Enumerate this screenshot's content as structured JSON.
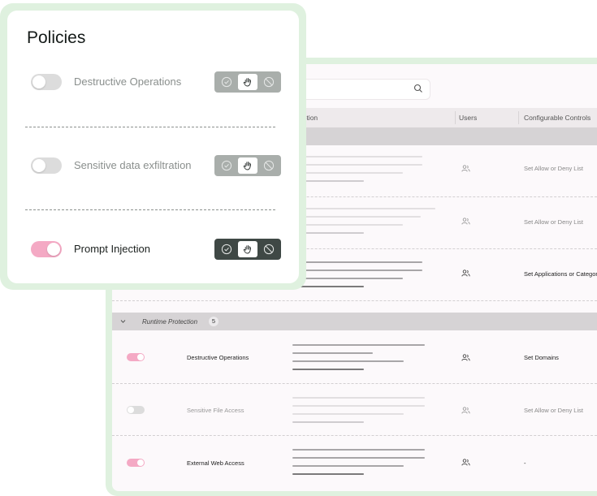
{
  "policies_card": {
    "title": "Policies",
    "items": [
      {
        "label": "Destructive Operations",
        "enabled": false,
        "selected_action": "hand"
      },
      {
        "label": "Sensitive data exfiltration",
        "enabled": false,
        "selected_action": "hand"
      },
      {
        "label": "Prompt Injection",
        "enabled": true,
        "selected_action": "hand"
      }
    ],
    "actions": [
      "check-icon",
      "hand-icon",
      "block-icon"
    ]
  },
  "table": {
    "columns": {
      "description": "ription",
      "users": "Users",
      "controls": "Configurable Controls"
    },
    "rows_top": [
      {
        "control": "Set Allow or Deny List",
        "muted": true
      },
      {
        "control": "Set Allow or Deny List",
        "muted": true
      },
      {
        "control": "Set Applications or Categor",
        "muted": false
      }
    ],
    "group": {
      "label": "Runtime Protection",
      "count": "5"
    },
    "rows_group": [
      {
        "name": "Destructive Operations",
        "control": "Set Domains",
        "enabled": true,
        "muted": false
      },
      {
        "name": "Sensitive File Access",
        "control": "Set Allow or Deny List",
        "enabled": false,
        "muted": true
      },
      {
        "name": "External Web Access",
        "control": "-",
        "enabled": true,
        "muted": false
      }
    ]
  },
  "colors": {
    "accent_green_frame": "#dff1df",
    "toggle_on": "#f4a9c4",
    "toggle_off": "#dcdcdc",
    "seg_active_bg": "#3f4845",
    "seg_inactive_bg": "#a9aeab"
  }
}
